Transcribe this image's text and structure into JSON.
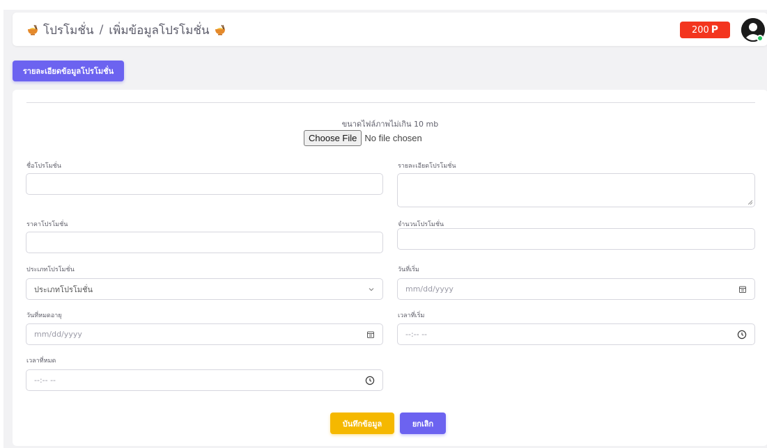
{
  "header": {
    "breadcrumb_section": "โปรโมชั่น",
    "breadcrumb_separator": "/",
    "breadcrumb_page": "เพิ่มข้อมูลโปรโมชั่น",
    "icon": "noodle-bowl-icon",
    "coin_amount": "200",
    "coin_symbol": "P",
    "avatar_icon": "user-avatar-icon",
    "status": "online"
  },
  "tab": {
    "label": "รายละเอียดข้อมูลโปรโมชั่น"
  },
  "upload": {
    "note": "ขนาดไฟล์ภาพไม่เกิน 10 mb",
    "button_label": "Choose File",
    "status": "No file chosen"
  },
  "form": {
    "name_label": "ชื่อโปรโมชั่น",
    "name_value": "",
    "detail_label": "รายละเอียดโปรโมชั่น",
    "detail_value": "",
    "price_label": "ราคาโปรโมชั่น",
    "price_value": "",
    "quantity_label": "จำนวนโปรโมชั่น",
    "quantity_value": "",
    "type_label": "ประเภทโปรโมชั่น",
    "type_selected": "ประเภทโปรโมชั่น",
    "start_date_label": "วันที่เริ่ม",
    "start_date_placeholder": "mm/dd/yyyy",
    "expire_date_label": "วันที่หมดอายุ",
    "expire_date_placeholder": "mm/dd/yyyy",
    "start_time_label": "เวลาที่เริ่ม",
    "start_time_placeholder": "--:-- --",
    "end_time_label": "เวลาที่หมด",
    "end_time_placeholder": "--:-- --"
  },
  "actions": {
    "save_label": "บันทึกข้อมูล",
    "cancel_label": "ยกเลิก"
  },
  "colors": {
    "accent": "#6c63f0",
    "save": "#f5b800",
    "coin_badge": "#f3351e",
    "online": "#22c55e"
  }
}
